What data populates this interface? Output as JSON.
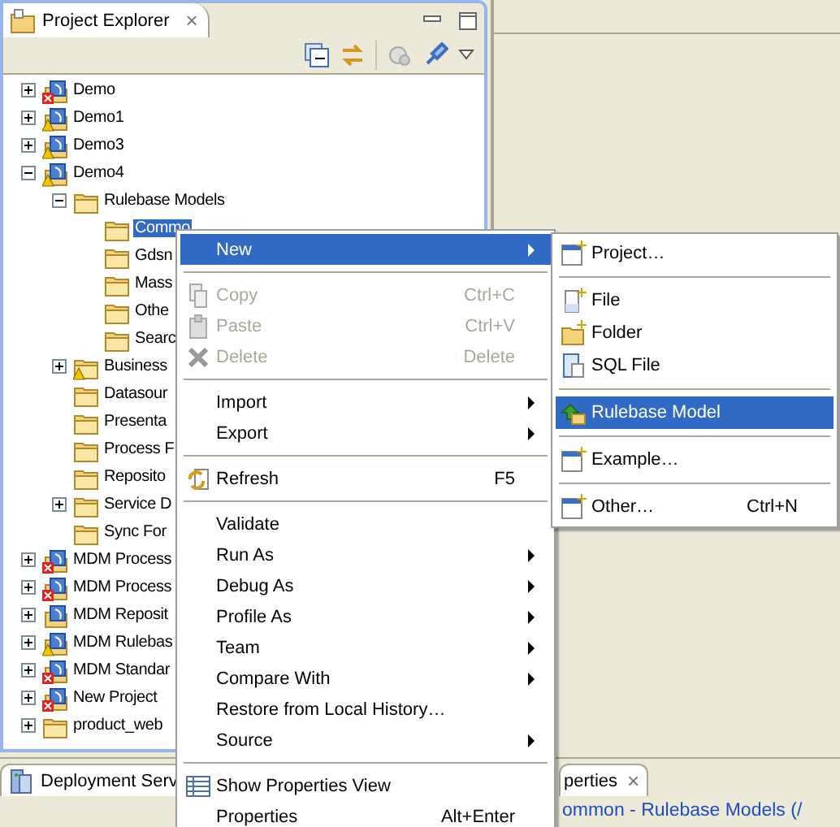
{
  "explorer": {
    "title": "Project Explorer",
    "close": "×",
    "tree": [
      {
        "label": "Demo",
        "kind": "project",
        "error": true,
        "warning": false,
        "expanded": false
      },
      {
        "label": "Demo1",
        "kind": "project",
        "error": false,
        "warning": true,
        "expanded": false
      },
      {
        "label": "Demo3",
        "kind": "project",
        "error": false,
        "warning": true,
        "expanded": false
      },
      {
        "label": "Demo4",
        "kind": "project",
        "error": false,
        "warning": true,
        "expanded": true,
        "children": [
          {
            "label": "Rulebase Models",
            "kind": "folder",
            "error": false,
            "warning": false,
            "expanded": true,
            "children": [
              {
                "label": "Commo",
                "kind": "folder",
                "error": false,
                "warning": false,
                "selected": true
              },
              {
                "label": "Gdsn",
                "kind": "folder",
                "error": false,
                "warning": false,
                "selected": false
              },
              {
                "label": "Mass",
                "kind": "folder",
                "error": false,
                "warning": false,
                "selected": false
              },
              {
                "label": "Othe",
                "kind": "folder",
                "error": false,
                "warning": false,
                "selected": false
              },
              {
                "label": "Searc",
                "kind": "folder",
                "error": false,
                "warning": false,
                "selected": false
              }
            ]
          },
          {
            "label": "Business",
            "kind": "folder",
            "error": false,
            "warning": true,
            "expanded": false
          },
          {
            "label": "Datasour",
            "kind": "folder",
            "error": false,
            "warning": false
          },
          {
            "label": "Presenta",
            "kind": "folder",
            "error": false,
            "warning": false
          },
          {
            "label": "Process F",
            "kind": "folder",
            "error": false,
            "warning": false
          },
          {
            "label": "Reposito",
            "kind": "folder",
            "error": false,
            "warning": false
          },
          {
            "label": "Service D",
            "kind": "folder",
            "error": false,
            "warning": false,
            "expanded": false
          },
          {
            "label": "Sync For",
            "kind": "folder",
            "error": false,
            "warning": false
          }
        ]
      },
      {
        "label": "MDM Process",
        "kind": "project",
        "error": true,
        "warning": false,
        "expanded": false
      },
      {
        "label": "MDM Process",
        "kind": "project",
        "error": true,
        "warning": false,
        "expanded": false
      },
      {
        "label": "MDM Reposit",
        "kind": "project",
        "error": false,
        "warning": false,
        "expanded": false
      },
      {
        "label": "MDM Rulebas",
        "kind": "project",
        "error": false,
        "warning": true,
        "expanded": false
      },
      {
        "label": "MDM Standar",
        "kind": "project",
        "error": true,
        "warning": false,
        "expanded": false
      },
      {
        "label": "New Project",
        "kind": "project",
        "error": true,
        "warning": false,
        "expanded": false
      },
      {
        "label": "product_web",
        "kind": "folder",
        "error": false,
        "warning": false,
        "expanded": false
      }
    ]
  },
  "bottom_left_tab": {
    "title": "Deployment Serv"
  },
  "bottom_right_tab": {
    "title": "perties",
    "close": "×",
    "content": "ommon - Rulebase Models (/"
  },
  "context_menu": [
    {
      "kind": "item",
      "label": "New",
      "submenu": true,
      "selected": true,
      "disabled": false
    },
    {
      "kind": "separator"
    },
    {
      "kind": "item",
      "label": "Copy",
      "shortcut": "Ctrl+C",
      "submenu": false,
      "selected": false,
      "disabled": true
    },
    {
      "kind": "item",
      "label": "Paste",
      "shortcut": "Ctrl+V",
      "submenu": false,
      "selected": false,
      "disabled": true
    },
    {
      "kind": "item",
      "label": "Delete",
      "shortcut": "Delete",
      "submenu": false,
      "selected": false,
      "disabled": true
    },
    {
      "kind": "separator"
    },
    {
      "kind": "item",
      "label": "Import",
      "submenu": true,
      "selected": false,
      "disabled": false
    },
    {
      "kind": "item",
      "label": "Export",
      "submenu": true,
      "selected": false,
      "disabled": false
    },
    {
      "kind": "separator"
    },
    {
      "kind": "item",
      "label": "Refresh",
      "shortcut": "F5",
      "submenu": false,
      "selected": false,
      "disabled": false
    },
    {
      "kind": "separator"
    },
    {
      "kind": "item",
      "label": "Validate",
      "submenu": false,
      "selected": false,
      "disabled": false
    },
    {
      "kind": "item",
      "label": "Run As",
      "submenu": true,
      "selected": false,
      "disabled": false
    },
    {
      "kind": "item",
      "label": "Debug As",
      "submenu": true,
      "selected": false,
      "disabled": false
    },
    {
      "kind": "item",
      "label": "Profile As",
      "submenu": true,
      "selected": false,
      "disabled": false
    },
    {
      "kind": "item",
      "label": "Team",
      "submenu": true,
      "selected": false,
      "disabled": false
    },
    {
      "kind": "item",
      "label": "Compare With",
      "submenu": true,
      "selected": false,
      "disabled": false
    },
    {
      "kind": "item",
      "label": "Restore from Local History…",
      "submenu": false,
      "selected": false,
      "disabled": false
    },
    {
      "kind": "item",
      "label": "Source",
      "submenu": true,
      "selected": false,
      "disabled": false
    },
    {
      "kind": "separator"
    },
    {
      "kind": "item",
      "label": "Show Properties View",
      "submenu": false,
      "selected": false,
      "disabled": false
    },
    {
      "kind": "item",
      "label": "Properties",
      "shortcut": "Alt+Enter",
      "submenu": false,
      "selected": false,
      "disabled": false
    }
  ],
  "new_submenu": [
    {
      "kind": "item",
      "label": "Project…",
      "selected": false
    },
    {
      "kind": "separator"
    },
    {
      "kind": "item",
      "label": "File",
      "selected": false
    },
    {
      "kind": "item",
      "label": "Folder",
      "selected": false
    },
    {
      "kind": "item",
      "label": "SQL File",
      "selected": false
    },
    {
      "kind": "separator"
    },
    {
      "kind": "item",
      "label": "Rulebase Model",
      "selected": true
    },
    {
      "kind": "separator"
    },
    {
      "kind": "item",
      "label": "Example…",
      "selected": false
    },
    {
      "kind": "separator"
    },
    {
      "kind": "item",
      "label": "Other…",
      "shortcut": "Ctrl+N",
      "selected": false
    }
  ]
}
